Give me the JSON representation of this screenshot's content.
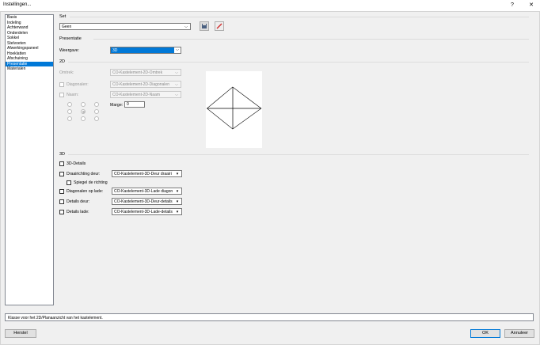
{
  "window": {
    "title": "Instellingen...",
    "help_label": "?",
    "close_label": "✕"
  },
  "sidebar": {
    "items": [
      {
        "label": "Basis",
        "selected": false
      },
      {
        "label": "Indeling",
        "selected": false
      },
      {
        "label": "Achterwand",
        "selected": false
      },
      {
        "label": "Onderdelen",
        "selected": false
      },
      {
        "label": "Sokkel",
        "selected": false
      },
      {
        "label": "Stelvoeten",
        "selected": false
      },
      {
        "label": "Afwerkingspaneel",
        "selected": false
      },
      {
        "label": "Hoeklatten",
        "selected": false
      },
      {
        "label": "Afschuining",
        "selected": false
      },
      {
        "label": "Presentatie",
        "selected": true
      },
      {
        "label": "Materialen",
        "selected": false
      }
    ]
  },
  "set": {
    "heading": "Set",
    "value": "Geen"
  },
  "presentatie": {
    "heading": "Presentatie",
    "weergave_label": "Weergave:",
    "weergave_value": "3D"
  },
  "d2": {
    "heading": "2D",
    "omtrek_label": "Omtrek:",
    "omtrek_value": "CO-Kastelement-2D-Omtrek",
    "diagonalen_label": "Diagonalen:",
    "diagonalen_value": "CO-Kastelement-2D-Diagonalen",
    "naam_label": "Naam:",
    "naam_value": "CO-Kastelement-2D-Naam",
    "marge_label": "Marge:",
    "marge_value": "0"
  },
  "d3": {
    "heading": "3D",
    "details_label": "3D-Details",
    "rows": [
      {
        "label": "Draairichting deur:",
        "value": "CO-Kastelement-3D-Deur draairi"
      },
      {
        "label": "Diagonalen op lade:",
        "value": "CO-Kastelement-3D-Lade diagon"
      },
      {
        "label": "Details deur:",
        "value": "CO-Kastelement-3D-Deur-details"
      },
      {
        "label": "Details lade:",
        "value": "CO-Kastelement-3D-Lade-details"
      }
    ],
    "spiegel_label": "Spiegel de richting"
  },
  "status_text": "Klasse voor het 2D/Planaanzicht van het kastelement.",
  "buttons": {
    "herstel": "Herstel",
    "ok": "OK",
    "annuleer": "Annuleer"
  },
  "icons": {
    "save": "save-icon",
    "pencil": "pencil-icon",
    "dropdown": "chevron-down-icon"
  },
  "colors": {
    "accent": "#0078d7"
  }
}
